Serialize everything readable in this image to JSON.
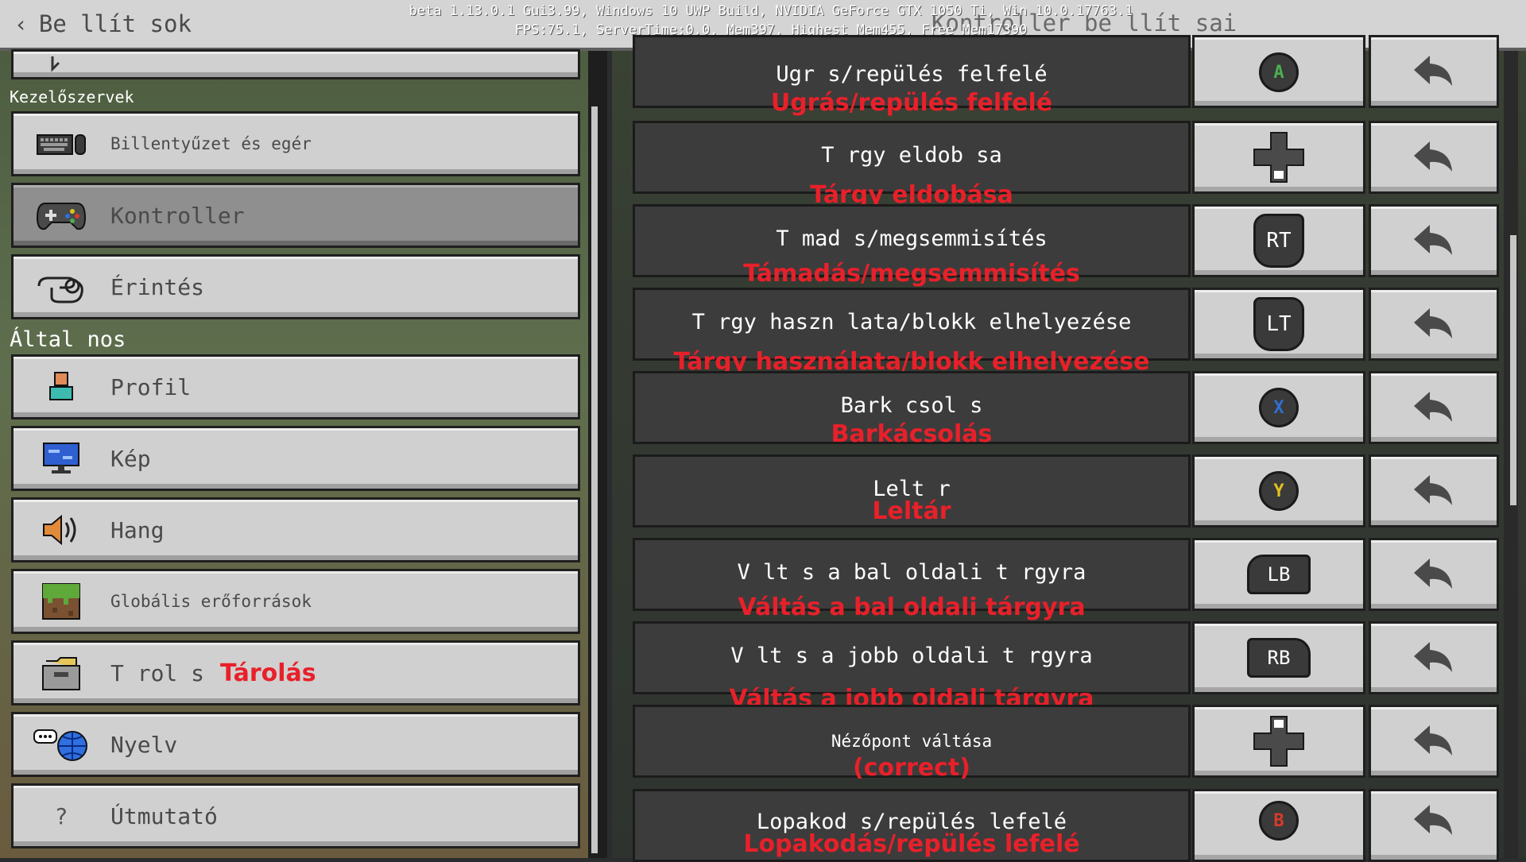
{
  "header": {
    "back_label": "Be llít sok",
    "title": "Kontroller be llít sai",
    "debug_line1": "beta 1.13.0.1 Gui3.99, Windows 10 UWP Build, NVIDIA GeForce GTX 1050 Ti, Win 10.0.17763.1",
    "debug_line2": "FPS:75.1, ServerTime:0.0, Mem397, Highest Mem455, Free Mem17390"
  },
  "sidebar": {
    "section_controls": "Kezelőszervek",
    "section_general": "Által nos",
    "items": [
      {
        "label": "Billentyűzet és egér",
        "icon": "keyboard-mouse-icon"
      },
      {
        "label": "Kontroller",
        "icon": "gamepad-icon",
        "active": true
      },
      {
        "label": "Érintés",
        "icon": "touch-hand-icon"
      },
      {
        "label": "Profil",
        "icon": "profile-icon"
      },
      {
        "label": "Kép",
        "icon": "monitor-icon"
      },
      {
        "label": "Hang",
        "icon": "speaker-icon"
      },
      {
        "label": "Globális erőforrások",
        "icon": "grass-block-icon"
      },
      {
        "label": "T rol s",
        "icon": "storage-box-icon",
        "annotation": "Tárolás"
      },
      {
        "label": "Nyelv",
        "icon": "language-globe-icon"
      },
      {
        "label": "Útmutató",
        "icon": "help-question-icon"
      }
    ]
  },
  "bindings": [
    {
      "name": "Ugr s/repülés felfelé",
      "annotation": "Ugrás/repülés felfelé",
      "button": "A",
      "button_color": "#4caf50"
    },
    {
      "name": "T rgy eldob sa",
      "annotation": "Tárgy eldobása",
      "button": "dpad-down"
    },
    {
      "name": "T mad s/megsemmisítés",
      "annotation": "Támadás/megsemmisítés",
      "button": "RT"
    },
    {
      "name": "T rgy haszn lata/blokk elhelyezése",
      "annotation": "Tárgy használata/blokk elhelyezése",
      "button": "LT"
    },
    {
      "name": "Bark csol s",
      "annotation": "Barkácsolás",
      "button": "X",
      "button_color": "#2f6fd6"
    },
    {
      "name": "Lelt r",
      "annotation": "Leltár",
      "button": "Y",
      "button_color": "#e0c21c"
    },
    {
      "name": "V lt s a bal oldali t rgyra",
      "annotation": "Váltás a bal oldali tárgyra",
      "button": "LB"
    },
    {
      "name": "V lt s a jobb oldali t rgyra",
      "annotation": "Váltás a jobb oldali tárgyra",
      "button": "RB"
    },
    {
      "name": "Nézőpont váltása",
      "annotation": "(correct)",
      "button": "dpad-up"
    },
    {
      "name": "Lopakod s/repülés lefelé",
      "annotation": "Lopakodás/repülés lefelé",
      "button": "B",
      "button_color": "#d83a2a"
    }
  ],
  "colors": {
    "annotation": "#e8202a",
    "panel": "#3c3c3c",
    "button": "#d0d0d0"
  }
}
